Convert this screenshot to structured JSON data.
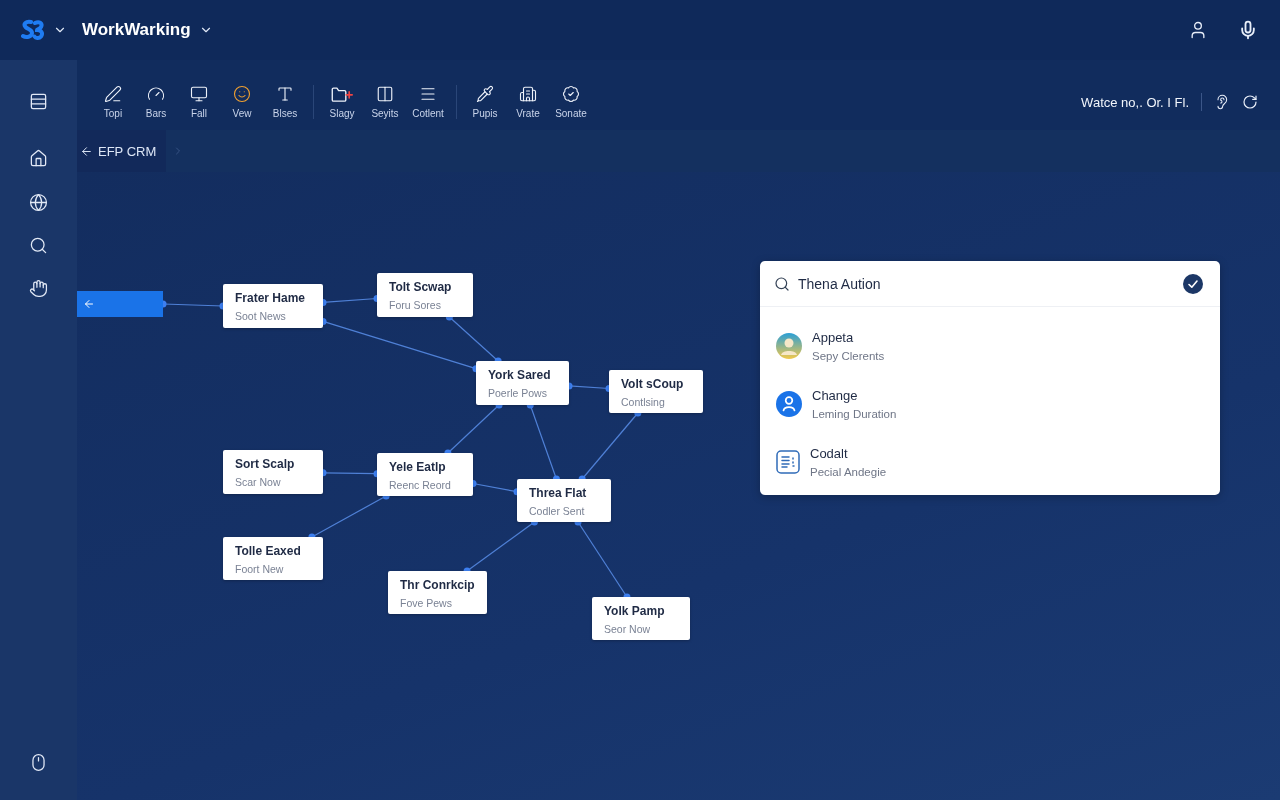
{
  "header": {
    "app_name": "WorkWarking"
  },
  "toolbar": {
    "groups": [
      {
        "items": [
          {
            "label": "Topi"
          },
          {
            "label": "Bars"
          },
          {
            "label": "Fall"
          },
          {
            "label": "Vew"
          },
          {
            "label": "Blses"
          }
        ]
      },
      {
        "items": [
          {
            "label": "Slagy"
          },
          {
            "label": "Seyits"
          },
          {
            "label": "Cotlent"
          }
        ]
      },
      {
        "items": [
          {
            "label": "Pupis"
          },
          {
            "label": "Vrate"
          },
          {
            "label": "Sonate"
          }
        ]
      }
    ],
    "status_text": "Watce no,. Or. I Fl."
  },
  "breadcrumb": {
    "label": "EFP CRM"
  },
  "diagram": {
    "nodes": [
      {
        "title": "Frater Hame",
        "subtitle": "Soot News"
      },
      {
        "title": "Tolt Scwap",
        "subtitle": "Foru Sores"
      },
      {
        "title": "York Sared",
        "subtitle": "Poerle Pows"
      },
      {
        "title": "Volt sCoup",
        "subtitle": "Contlsing"
      },
      {
        "title": "Sort Scalp",
        "subtitle": "Scar Now"
      },
      {
        "title": "Yele Eatlp",
        "subtitle": "Reenc Reord"
      },
      {
        "title": "Tolle Eaxed",
        "subtitle": "Foort New"
      },
      {
        "title": "Threa Flat",
        "subtitle": "Codler Sent"
      },
      {
        "title": "Thr Conrkcip",
        "subtitle": "Fove Pews"
      },
      {
        "title": "Yolk Pamp",
        "subtitle": "Seor Now"
      }
    ]
  },
  "panel": {
    "search": {
      "value": "Thena Aution"
    },
    "items": [
      {
        "kind": "avatar",
        "title": "Appeta",
        "subtitle": "Sepy Clerents"
      },
      {
        "kind": "person",
        "title": "Change",
        "subtitle": "Leming Duration"
      },
      {
        "kind": "document",
        "title": "Codalt",
        "subtitle": "Pecial Andegie"
      }
    ]
  }
}
